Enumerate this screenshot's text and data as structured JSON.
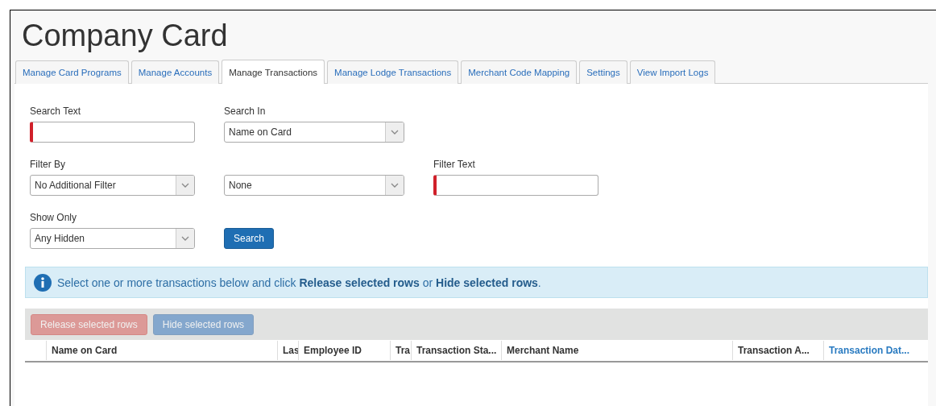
{
  "title": "Company Card",
  "tabs": [
    {
      "label": "Manage Card Programs",
      "selected": false
    },
    {
      "label": "Manage Accounts",
      "selected": false
    },
    {
      "label": "Manage Transactions",
      "selected": true
    },
    {
      "label": "Manage Lodge Transactions",
      "selected": false
    },
    {
      "label": "Merchant Code Mapping",
      "selected": false
    },
    {
      "label": "Settings",
      "selected": false
    },
    {
      "label": "View Import Logs",
      "selected": false
    }
  ],
  "form": {
    "rows": [
      [
        {
          "kind": "text",
          "label": "Search Text",
          "required": true
        },
        {
          "kind": "select",
          "label": "Search In",
          "value": "Name on Card"
        }
      ],
      [
        {
          "kind": "select",
          "label": "Filter By",
          "value": "No Additional Filter"
        },
        {
          "kind": "select",
          "value": "None"
        },
        {
          "kind": "text",
          "label": "Filter Text",
          "required": true
        }
      ],
      [
        {
          "kind": "select",
          "label": "Show Only",
          "value": "Any Hidden"
        },
        {
          "kind": "button",
          "label": "Search"
        }
      ]
    ]
  },
  "info": {
    "message": "Select one or more transactions below and click **Release selected rows** or **Hide selected rows**."
  },
  "actions": [
    {
      "label": "Release selected rows",
      "kind": "danger",
      "disabled": true
    },
    {
      "label": "Hide selected rows",
      "kind": "primary",
      "disabled": true
    }
  ],
  "table": {
    "columns": [
      {
        "label": "Name on Card",
        "sorted": false
      },
      {
        "label": "Las",
        "sorted": false
      },
      {
        "label": "Employee ID",
        "sorted": false
      },
      {
        "label": "Tra",
        "sorted": false
      },
      {
        "label": "Transaction Sta...",
        "sorted": false
      },
      {
        "label": "Merchant Name",
        "sorted": false
      },
      {
        "label": "Transaction A...",
        "sorted": false
      },
      {
        "label": "Transaction Dat...",
        "sorted": true
      }
    ]
  }
}
